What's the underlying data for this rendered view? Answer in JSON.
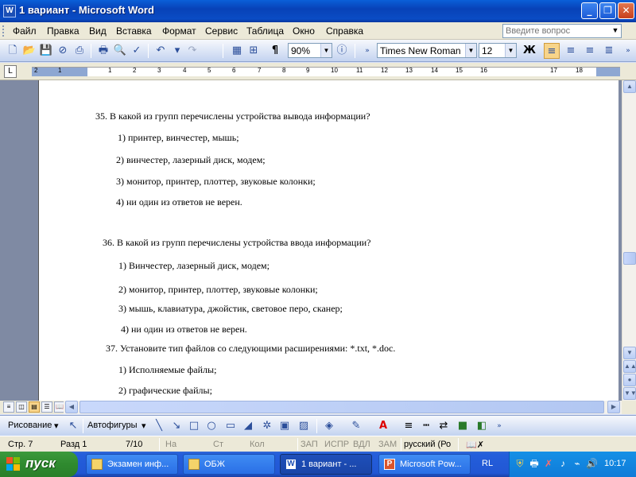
{
  "window": {
    "title": "1 вариант - Microsoft Word",
    "app_icon": "W"
  },
  "menu": {
    "items": [
      "Файл",
      "Правка",
      "Вид",
      "Вставка",
      "Формат",
      "Сервис",
      "Таблица",
      "Окно",
      "Справка"
    ],
    "help_placeholder": "Введите вопрос"
  },
  "toolbar": {
    "zoom": "90%",
    "font": "Times New Roman",
    "size": "12",
    "bold_label": "Ж",
    "paragraph_mark": "¶"
  },
  "ruler": {
    "numbers": [
      "2",
      "1",
      "1",
      "2",
      "3",
      "4",
      "5",
      "6",
      "7",
      "8",
      "9",
      "10",
      "11",
      "12",
      "13",
      "14",
      "15",
      "16",
      "17",
      "18"
    ]
  },
  "document": {
    "lines": [
      "35. В какой из групп перечислены устройства вывода информации?",
      "1)   принтер, винчестер, мышь;",
      "2)  винчестер, лазерный диск, модем;",
      "3)  монитор, принтер, плоттер, звуковые колонки;",
      "4)  ни один из ответов не верен.",
      "36.  В какой из групп перечислены устройства ввода информации?",
      "1) Винчестер, лазерный диск, модем;",
      "2) монитор, принтер, плоттер, звуковые колонки;",
      "3) мышь, клавиатура, джойстик, световое перо, сканер;",
      "4) ни один из ответов не верен.",
      "37. Установите тип файлов со следующими расширениями: *.txt, *.doc.",
      "1) Исполняемые файлы;",
      "2) графические файлы;"
    ]
  },
  "drawing": {
    "draw_label": "Рисование",
    "autoshapes_label": "Автофигуры"
  },
  "status": {
    "page": "Стр.  7",
    "section": "Разд  1",
    "pages": "7/10",
    "at": "На",
    "line": "Ст",
    "col": "Кол",
    "rec": "ЗАП",
    "trk": "ИСПР",
    "ext": "ВДЛ",
    "ovr": "ЗАМ",
    "lang": "русский (Ро"
  },
  "taskbar": {
    "start_label": "пуск",
    "tasks": [
      "Экзамен инф...",
      "ОБЖ",
      "1 вариант - ...",
      "Microsoft Pow..."
    ],
    "lang": "RL",
    "clock": "10:17"
  }
}
